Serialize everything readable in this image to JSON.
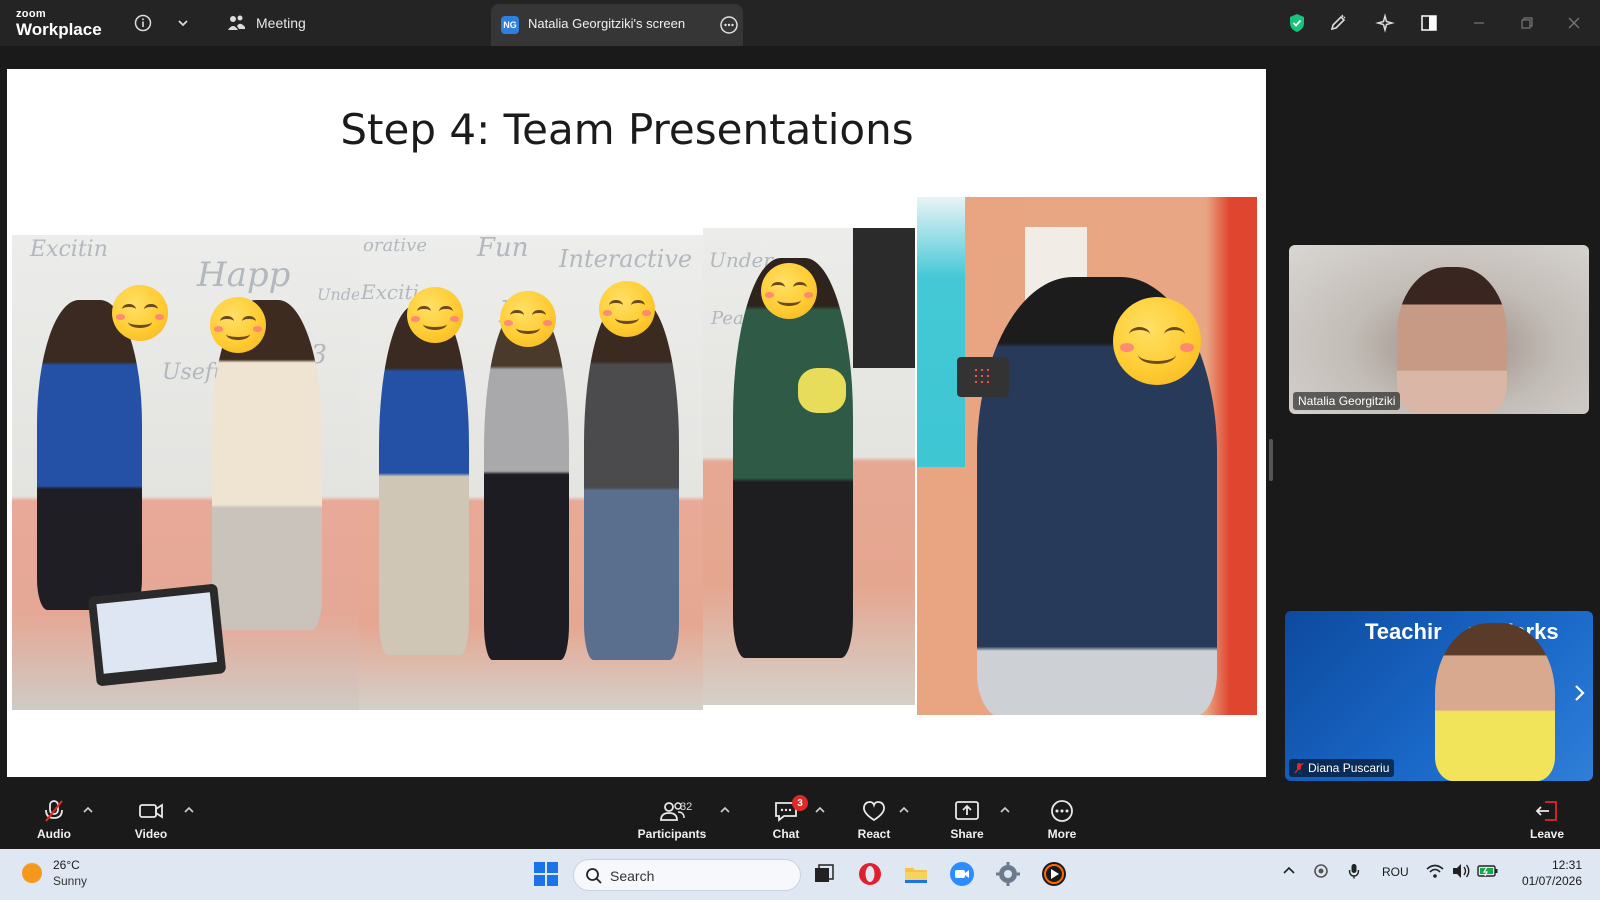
{
  "titlebar": {
    "brand_top": "zoom",
    "brand_bottom": "Workplace",
    "meeting_label": "Meeting",
    "share_tab_initials": "NG",
    "share_tab_label": "Natalia Georgitziki's screen"
  },
  "slide": {
    "title": "Step 4: Team Presentations",
    "whiteboard_words": [
      "Excitin",
      "Happ",
      "Under",
      "Usefu",
      "13",
      "orative",
      "Fun",
      "Interactive",
      "Exciti",
      "H",
      "Under",
      "Pean"
    ]
  },
  "video_tiles": [
    {
      "name": "Natalia Georgitziki"
    },
    {
      "name": "Diana Puscariu",
      "muted": true,
      "banner_text": "Teachir    at Works"
    }
  ],
  "toolbar": {
    "audio_label": "Audio",
    "video_label": "Video",
    "participants_label": "Participants",
    "participants_count": "32",
    "chat_label": "Chat",
    "chat_badge": "3",
    "react_label": "React",
    "share_label": "Share",
    "more_label": "More",
    "leave_label": "Leave"
  },
  "taskbar": {
    "temperature": "26°C",
    "weather": "Sunny",
    "search_label": "Search",
    "language": "ROU",
    "time": "12:31",
    "date": "01/07/2026"
  },
  "colors": {
    "titlebar_bg": "#242424",
    "share_tab_bg": "#363636",
    "toolbar_bg": "#1a1a1a",
    "taskbar_bg": "#dfe8f2",
    "shield_green": "#19c37d",
    "leave_red": "#e02828"
  }
}
